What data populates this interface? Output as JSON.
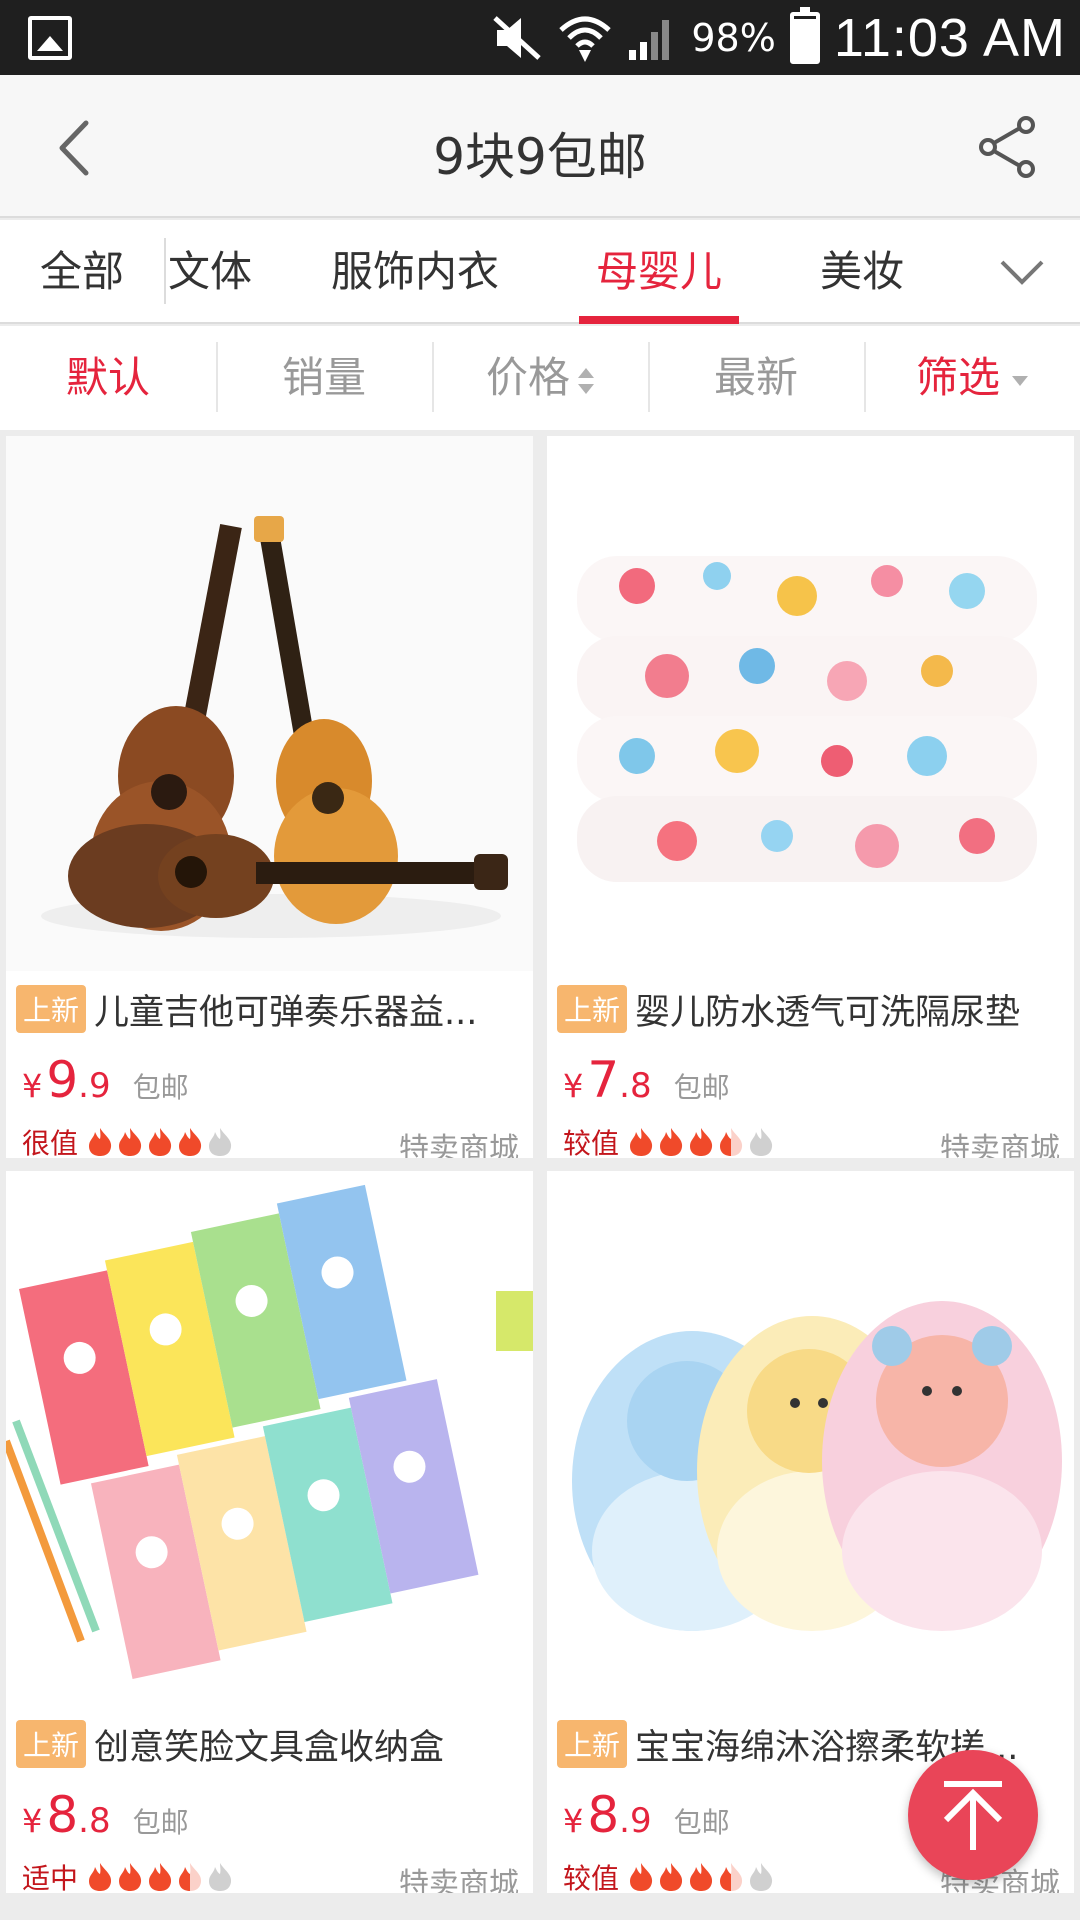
{
  "status_bar": {
    "battery": "98%",
    "time": "11:03 AM"
  },
  "header": {
    "title": "9块9包邮"
  },
  "category_tabs": [
    {
      "label": "全部"
    },
    {
      "label": "文体"
    },
    {
      "label": "服饰内衣"
    },
    {
      "label": "母婴儿童"
    },
    {
      "label": "美妆"
    }
  ],
  "category_active": "母婴儿童",
  "sort_bar": {
    "items": [
      {
        "label": "默认"
      },
      {
        "label": "销量"
      },
      {
        "label": "价格"
      },
      {
        "label": "最新"
      },
      {
        "label": "筛选"
      }
    ],
    "active": "默认"
  },
  "products": [
    {
      "tag": "上新",
      "title": "儿童吉他可弹奏乐器益...",
      "price_int": "9",
      "price_dec": ".9",
      "currency": "¥",
      "shipping": "包邮",
      "value_label": "很值",
      "rating": 4,
      "rating_max": 5,
      "store": "特卖商城",
      "image": "toy-ukulele-image"
    },
    {
      "tag": "上新",
      "title": "婴儿防水透气可洗隔尿垫",
      "price_int": "7",
      "price_dec": ".8",
      "currency": "¥",
      "shipping": "包邮",
      "value_label": "较值",
      "rating": 3.5,
      "rating_max": 5,
      "store": "特卖商城",
      "image": "baby-pad-image"
    },
    {
      "tag": "上新",
      "title": "创意笑脸文具盒收纳盒",
      "price_int": "8",
      "price_dec": ".8",
      "currency": "¥",
      "shipping": "包邮",
      "value_label": "适中",
      "rating": 3.5,
      "rating_max": 5,
      "store": "特卖商城",
      "image": "pencil-box-image"
    },
    {
      "tag": "上新",
      "title": "宝宝海绵沐浴擦柔软搓...",
      "price_int": "8",
      "price_dec": ".9",
      "currency": "¥",
      "shipping": "包邮",
      "value_label": "较值",
      "rating": 3.5,
      "rating_max": 5,
      "store": "特卖商城",
      "image": "bath-sponge-image"
    }
  ],
  "colors": {
    "accent": "#e5243d",
    "tag": "#f7b66e",
    "value": "#c3161c",
    "flame": "#f04a2a",
    "flame_empty": "#d0d0d0"
  }
}
